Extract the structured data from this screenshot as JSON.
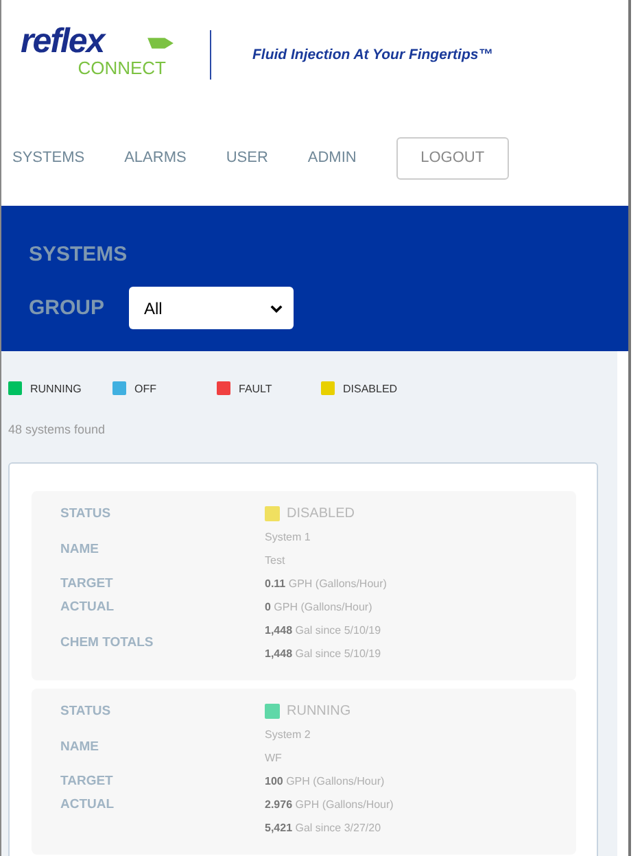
{
  "header": {
    "logo_top": "reflex",
    "logo_bottom": "CONNECT",
    "tagline": "Fluid Injection At Your Fingertips™"
  },
  "nav": {
    "links": [
      "SYSTEMS",
      "ALARMS",
      "USER",
      "ADMIN"
    ],
    "logout": "LOGOUT"
  },
  "banner": {
    "title": "SYSTEMS",
    "group_label": "GROUP",
    "group_value": "All"
  },
  "legend": [
    {
      "label": "RUNNING",
      "color": "#00c060"
    },
    {
      "label": "OFF",
      "color": "#40b0e0"
    },
    {
      "label": "FAULT",
      "color": "#f04040"
    },
    {
      "label": "DISABLED",
      "color": "#e8d000"
    }
  ],
  "count": "48 systems found",
  "systems": [
    {
      "rows": [
        {
          "label": "STATUS",
          "kind": "status",
          "color": "#f0e060",
          "values": [
            "DISABLED"
          ]
        },
        {
          "label": "NAME",
          "kind": "plain",
          "values": [
            "System 1",
            "Test"
          ]
        },
        {
          "label": "TARGET",
          "kind": "plain",
          "values": [
            "**0.11** GPH (Gallons/Hour)"
          ]
        },
        {
          "label": "ACTUAL",
          "kind": "plain",
          "values": [
            "**0** GPH (Gallons/Hour)"
          ]
        },
        {
          "label": "CHEM TOTALS",
          "kind": "plain",
          "values": [
            "**1,448** Gal since 5/10/19",
            "**1,448** Gal since 5/10/19"
          ]
        }
      ]
    },
    {
      "rows": [
        {
          "label": "STATUS",
          "kind": "status",
          "color": "#60d8a8",
          "values": [
            "RUNNING"
          ]
        },
        {
          "label": "NAME",
          "kind": "plain",
          "values": [
            "System 2",
            "WF"
          ]
        },
        {
          "label": "TARGET",
          "kind": "plain",
          "values": [
            "**100** GPH (Gallons/Hour)"
          ]
        },
        {
          "label": "ACTUAL",
          "kind": "plain",
          "values": [
            "**2.976** GPH (Gallons/Hour)"
          ]
        },
        {
          "label": "",
          "kind": "plain",
          "values": [
            "**5,421** Gal since 3/27/20"
          ]
        }
      ]
    }
  ]
}
